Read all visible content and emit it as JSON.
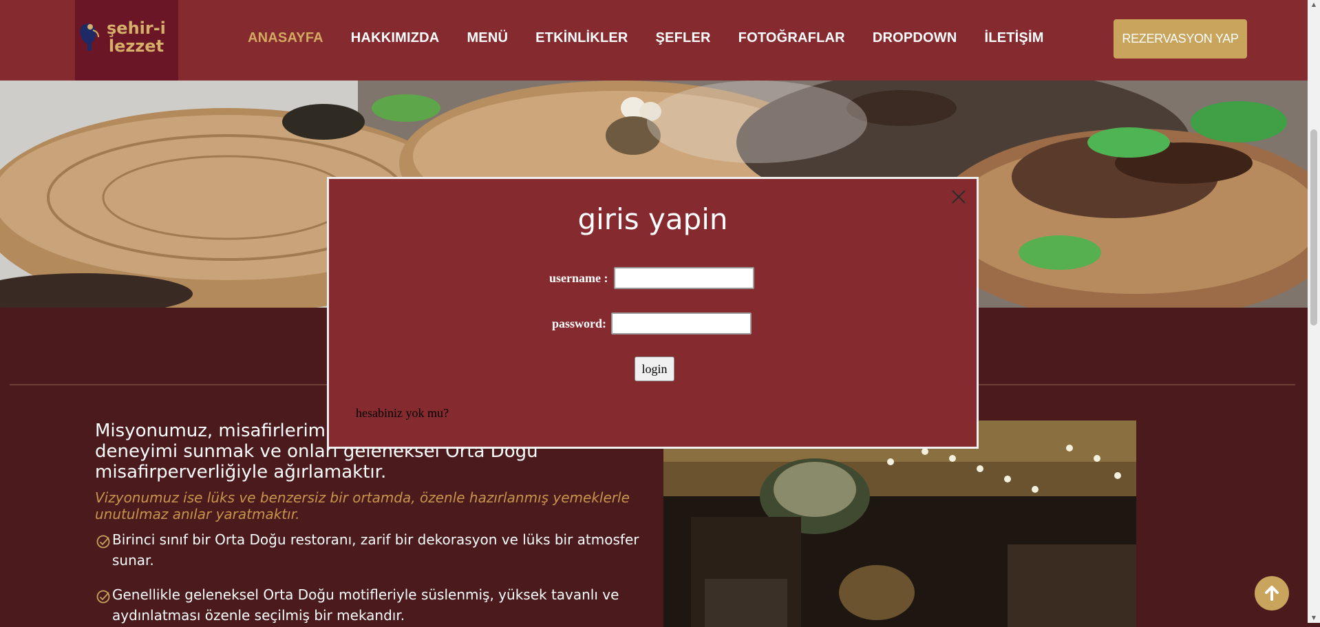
{
  "header": {
    "logo_text_line1": "şehir-i",
    "logo_text_line2": "lezzet",
    "nav": [
      {
        "label": "ANASAYFA",
        "active": true
      },
      {
        "label": "HAKKIMIZDA"
      },
      {
        "label": "MENÜ"
      },
      {
        "label": "ETKİNLİKLER"
      },
      {
        "label": "ŞEFLER"
      },
      {
        "label": "FOTOĞRAFLAR"
      },
      {
        "label": "DROPDOWN"
      },
      {
        "label": "İLETİŞİM"
      }
    ],
    "reserve_label": "REZERVASYON YAP"
  },
  "modal": {
    "title": "giris yapin",
    "username_label": "username :",
    "password_label": "password:",
    "username_value": "",
    "password_value": "",
    "login_label": "login",
    "signup_text": "hesabiniz yok mu?"
  },
  "about": {
    "mission": "Misyonumuz, misafirlerimize … deneyimi sunmak ve onları geleneksel Orta Doğu misafirperverliğiyle ağırlamaktır.",
    "mission_visible_line1": "Misyonumuz, misafirlerimiz",
    "mission_visible_line2": "deneyimi sunmak ve onları geleneksel Orta Doğu",
    "mission_visible_line3": "misafirperverliğiyle ağırlamaktır.",
    "vision": "Vizyonumuz ise lüks ve benzersiz bir ortamda, özenle hazırlanmış yemeklerle unutulmaz anılar yaratmaktır.",
    "items": [
      "Birinci sınıf bir Orta Doğu restoranı, zarif bir dekorasyon ve lüks bir atmosfer sunar.",
      "Genellikle geleneksel Orta Doğu motifleriyle süslenmiş, yüksek tavanlı ve aydınlatması özenle seçilmiş bir mekandır."
    ]
  },
  "colors": {
    "header_bg": "#852a2e",
    "accent_gold": "#c9a45d",
    "section_bg": "#4a1a1c"
  },
  "icons": {
    "close": "close-icon",
    "check": "check-circle-icon",
    "back_to_top": "arrow-up-icon"
  }
}
